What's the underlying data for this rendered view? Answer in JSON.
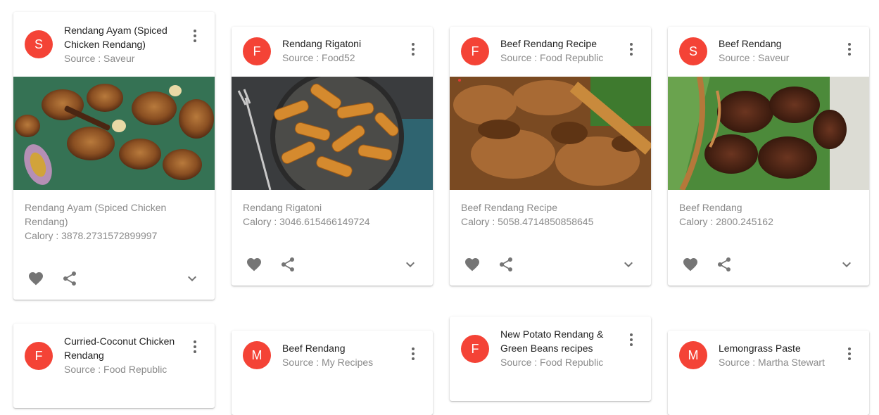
{
  "labels": {
    "calory_prefix": "Calory : "
  },
  "colors": {
    "avatar_bg": "#f44336",
    "icon_color": "#757575"
  },
  "cards": [
    {
      "avatar": "S",
      "title": "Rendang Ayam (Spiced Chicken Rendang)",
      "source": "Source : Saveur",
      "name": "Rendang Ayam (Spiced Chicken Rendang)",
      "calory": "Calory : 3878.2731572899997"
    },
    {
      "avatar": "F",
      "title": "Rendang Rigatoni",
      "source": "Source : Food52",
      "name": "Rendang Rigatoni",
      "calory": "Calory : 3046.615466149724"
    },
    {
      "avatar": "F",
      "title": "Beef Rendang Recipe",
      "source": "Source : Food Republic",
      "name": "Beef Rendang Recipe",
      "calory": "Calory : 5058.4714850858645"
    },
    {
      "avatar": "S",
      "title": "Beef Rendang",
      "source": "Source : Saveur",
      "name": "Beef Rendang",
      "calory": "Calory : 2800.245162"
    },
    {
      "avatar": "F",
      "title": "Curried-Coconut Chicken Rendang",
      "source": "Source : Food Republic"
    },
    {
      "avatar": "M",
      "title": "Beef Rendang",
      "source": "Source : My Recipes"
    },
    {
      "avatar": "F",
      "title": "New Potato Rendang & Green Beans recipes",
      "source": "Source : Food Republic"
    },
    {
      "avatar": "M",
      "title": "Lemongrass Paste",
      "source": "Source : Martha Stewart"
    }
  ]
}
